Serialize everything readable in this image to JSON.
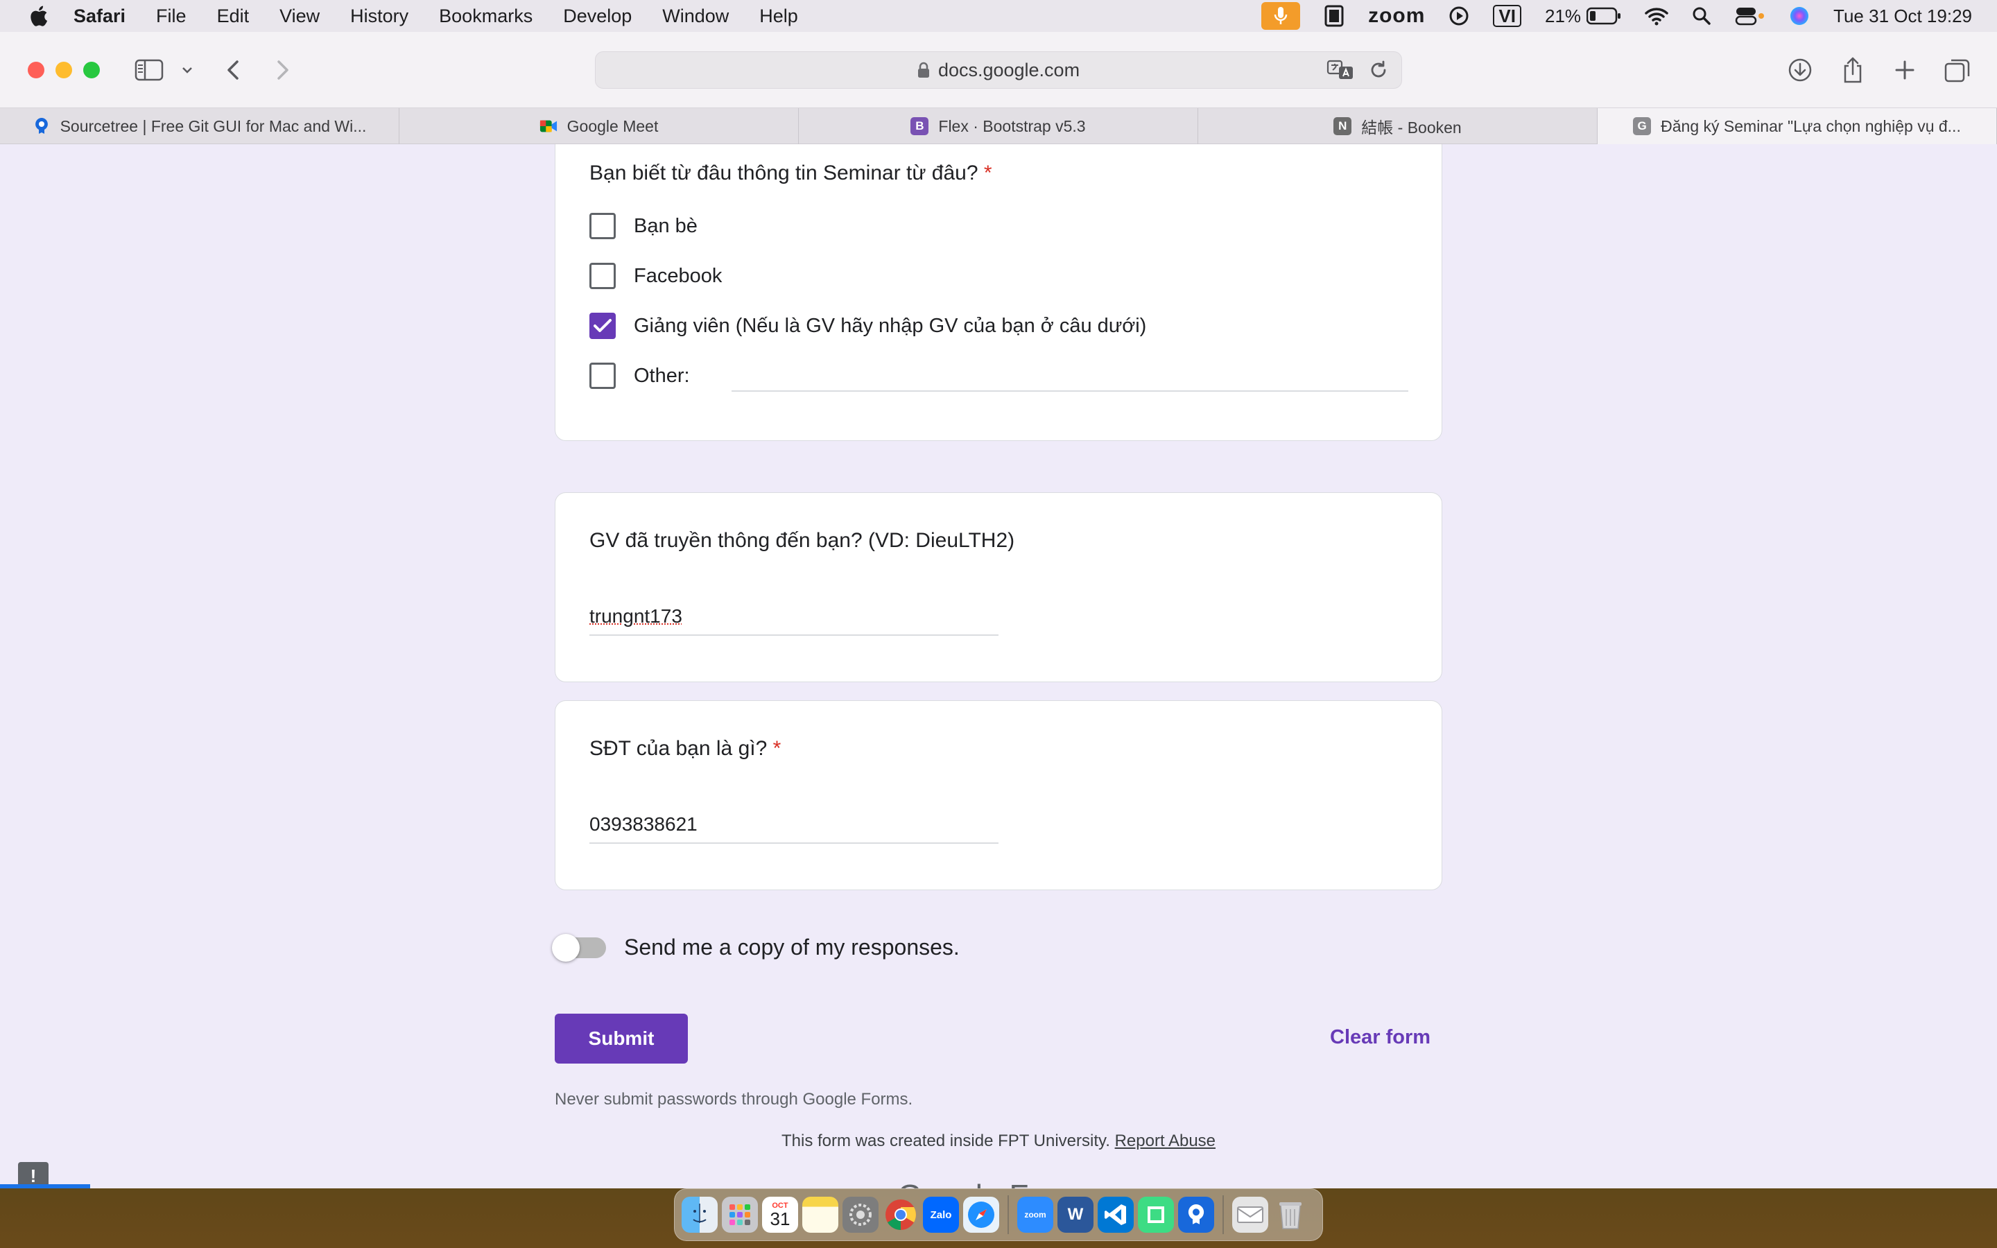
{
  "menubar": {
    "app": "Safari",
    "items": [
      "File",
      "Edit",
      "View",
      "History",
      "Bookmarks",
      "Develop",
      "Window",
      "Help"
    ],
    "status": {
      "zoom_label": "zoom",
      "input_source": "VI",
      "battery": "21%",
      "datetime": "Tue 31 Oct  19:29"
    }
  },
  "browser": {
    "address": "docs.google.com",
    "tabs": [
      {
        "label": "Sourcetree | Free Git GUI for Mac and Wi...",
        "favicon": "sourcetree-icon",
        "color": "#1868db"
      },
      {
        "label": "Google Meet",
        "favicon": "meet-icon",
        "color": "#00832d"
      },
      {
        "label": "Flex · Bootstrap v5.3",
        "favicon": "bootstrap-icon",
        "color": "#7952b3"
      },
      {
        "label": "結帳 - Booken",
        "favicon": "notion-icon",
        "color": "#6b6b6b"
      },
      {
        "label": "Đăng ký Seminar \"Lựa chọn nghiệp vụ đ...",
        "favicon": "google-icon",
        "color": "#8a8a8e"
      }
    ]
  },
  "form": {
    "q1": {
      "title": "Bạn biết từ đâu thông tin Seminar từ đâu?",
      "required": "*",
      "options": [
        {
          "label": "Bạn bè",
          "checked": false
        },
        {
          "label": "Facebook",
          "checked": false
        },
        {
          "label": "Giảng viên (Nếu là GV hãy nhập GV của bạn ở câu dưới)",
          "checked": true
        },
        {
          "label": "Other:",
          "checked": false
        }
      ]
    },
    "q2": {
      "title": "GV đã truyền thông đến bạn? (VD: DieuLTH2)",
      "answer": "trungnt173"
    },
    "q3": {
      "title": "SĐT của bạn là gì?",
      "required": "*",
      "answer": "0393838621"
    },
    "copy_toggle_label": "Send me a copy of my responses.",
    "copy_toggle_on": false,
    "submit_label": "Submit",
    "clear_label": "Clear form",
    "warning": "Never submit passwords through Google Forms.",
    "created_text": "This form was created inside FPT University.",
    "report_label": "Report Abuse",
    "brand": "Google Forms",
    "accent_color": "#673ab7"
  },
  "dock": {
    "apps": [
      {
        "name": "finder-icon",
        "color": "#3a8ee6"
      },
      {
        "name": "launchpad-icon",
        "color": "#9aa0a6"
      },
      {
        "name": "calendar-icon",
        "color": "#ffffff"
      },
      {
        "name": "notes-icon",
        "color": "#f7d54a"
      },
      {
        "name": "system-settings-icon",
        "color": "#7d7d7d"
      },
      {
        "name": "chrome-icon",
        "color": "#db4437"
      },
      {
        "name": "zalo-icon",
        "color": "#0068ff"
      },
      {
        "name": "safari-icon",
        "color": "#1e90ff"
      },
      {
        "name": "zoom-icon",
        "color": "#2d8cff"
      },
      {
        "name": "word-icon",
        "color": "#2b579a"
      },
      {
        "name": "vscode-icon",
        "color": "#0078d4"
      },
      {
        "name": "android-studio-icon",
        "color": "#3ddc84"
      },
      {
        "name": "sourcetree-icon",
        "color": "#1868db"
      },
      {
        "name": "mail-folder-icon",
        "color": "#e5e5e5"
      },
      {
        "name": "trash-icon",
        "color": "#cfcfcf"
      }
    ],
    "calendar_month": "OCT",
    "calendar_day": "31"
  }
}
